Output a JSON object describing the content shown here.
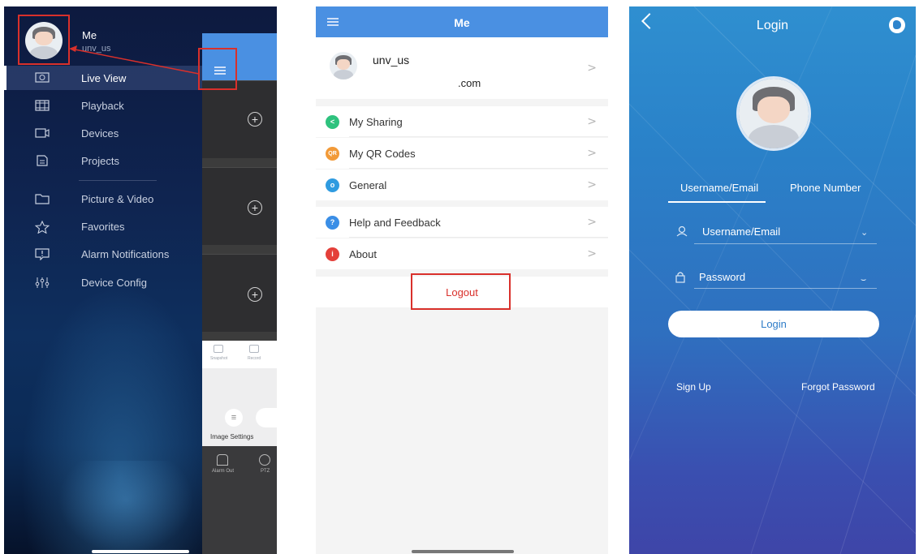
{
  "drawer": {
    "user_name": "Me",
    "user_sub": "unv_us",
    "items": [
      {
        "label": "Live View",
        "icon": "monitor-icon"
      },
      {
        "label": "Playback",
        "icon": "film-icon"
      },
      {
        "label": "Devices",
        "icon": "camera-icon"
      },
      {
        "label": "Projects",
        "icon": "folder-icon"
      },
      {
        "label": "Picture & Video",
        "icon": "folder-icon"
      },
      {
        "label": "Favorites",
        "icon": "star-icon"
      },
      {
        "label": "Alarm Notifications",
        "icon": "alarm-icon"
      },
      {
        "label": "Device Config",
        "icon": "sliders-icon"
      }
    ],
    "peek": {
      "snapshot_label": "Snapshot",
      "record_label": "Record",
      "image_settings_label": "Image Settings",
      "alarm_out_label": "Alarm Out",
      "ptz_label": "PTZ"
    }
  },
  "me_page": {
    "title": "Me",
    "profile_name": "unv_us",
    "profile_email": ".com",
    "rows": [
      {
        "label": "My Sharing",
        "color": "#2ec27e",
        "glyph": "<"
      },
      {
        "label": "My QR Codes",
        "color": "#f29a38",
        "glyph": "QR"
      },
      {
        "label": "General",
        "color": "#2f9be0",
        "glyph": "o"
      },
      {
        "label": "Help and Feedback",
        "color": "#3a8ee6",
        "glyph": "?"
      },
      {
        "label": "About",
        "color": "#e4403a",
        "glyph": "i"
      }
    ],
    "logout_label": "Logout"
  },
  "login": {
    "title": "Login",
    "tab_username": "Username/Email",
    "tab_phone": "Phone Number",
    "username_placeholder": "Username/Email",
    "password_placeholder": "Password",
    "login_button": "Login",
    "sign_up": "Sign Up",
    "forgot_password": "Forgot Password"
  },
  "colors": {
    "accent_blue": "#4a90e2",
    "highlight_red": "#d9302b"
  }
}
